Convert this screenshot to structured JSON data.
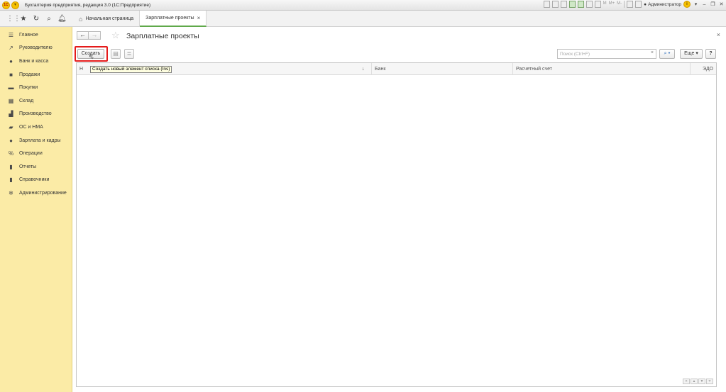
{
  "window": {
    "title": "Бухгалтерия предприятия, редакция 3.0  (1С:Предприятие)",
    "logo_text": "1С",
    "user_name": "Администратор"
  },
  "tabs": [
    {
      "label": "Начальная страница"
    },
    {
      "label": "Зарплатные проекты"
    }
  ],
  "sidebar": {
    "items": [
      {
        "label": "Главное",
        "icon": "menu-lines-icon"
      },
      {
        "label": "Руководителю",
        "icon": "trend-icon"
      },
      {
        "label": "Банк и касса",
        "icon": "coin-icon"
      },
      {
        "label": "Продажи",
        "icon": "bag-icon"
      },
      {
        "label": "Покупки",
        "icon": "cart-icon"
      },
      {
        "label": "Склад",
        "icon": "grid-icon"
      },
      {
        "label": "Производство",
        "icon": "factory-icon"
      },
      {
        "label": "ОС и НМА",
        "icon": "truck-icon"
      },
      {
        "label": "Зарплата и кадры",
        "icon": "person-icon"
      },
      {
        "label": "Операции",
        "icon": "percent-icon"
      },
      {
        "label": "Отчеты",
        "icon": "bar-chart-icon"
      },
      {
        "label": "Справочники",
        "icon": "book-icon"
      },
      {
        "label": "Администрирование",
        "icon": "gear-icon"
      }
    ]
  },
  "form": {
    "title": "Зарплатные проекты",
    "create_label": "Создать",
    "create_tooltip": "Создать новый элемент списка (Ins)",
    "search_placeholder": "Поиск (Ctrl+F)",
    "search_clear": "×",
    "more_label": "Еще",
    "help_label": "?",
    "columns": [
      {
        "label": "Н"
      },
      {
        "label": "Банк"
      },
      {
        "label": "Расчетный счет"
      },
      {
        "label": "ЭДО"
      }
    ],
    "rows": []
  },
  "colors": {
    "sidebar_bg": "#fbeba6",
    "active_tab_accent": "#5fa94a",
    "highlight": "#e41b1b",
    "tooltip_bg": "#ffffe1"
  }
}
